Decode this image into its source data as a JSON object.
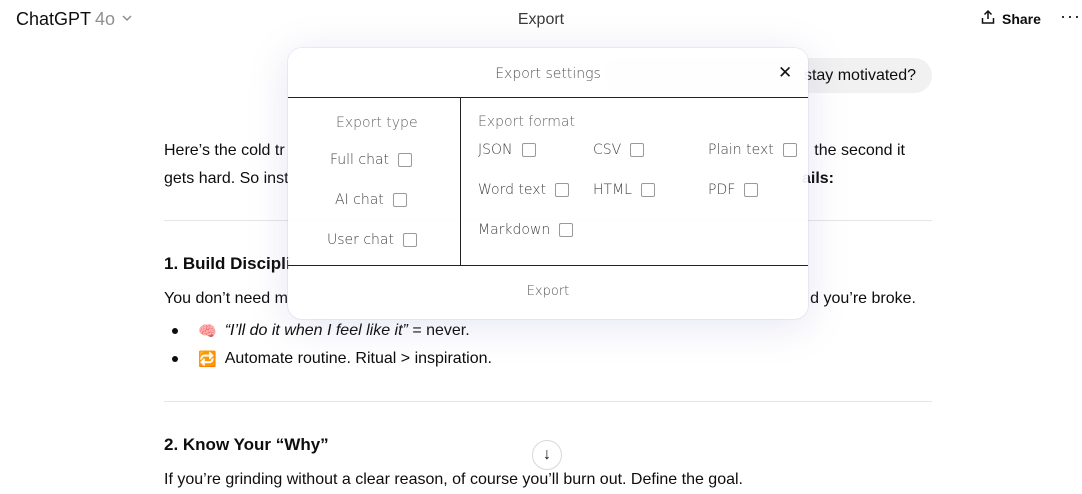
{
  "header": {
    "model_name": "ChatGPT",
    "model_version": "4o",
    "center_title": "Export",
    "share_label": "Share",
    "more_label": "···"
  },
  "conversation": {
    "user_message_visible": "stay motivated?",
    "intro_line1_left": "Here’s the cold tr",
    "intro_line1_right": "the second it",
    "intro_line2_left": "gets hard. So inst",
    "intro_line2_right": "ails:",
    "section1_heading": "1. Build Discipli",
    "section1_text_left": "You don’t need m",
    "section1_text_right": "d you’re broke.",
    "bullets": [
      {
        "emoji": "🧠",
        "text_italic": "“I’ll do it when I feel like it”",
        "text_rest": " = never."
      },
      {
        "emoji": "🔁",
        "text_italic": "",
        "text_rest": "Automate routine. Ritual > inspiration."
      }
    ],
    "section2_heading": "2. Know Your “Why”",
    "section2_text": "If you’re grinding without a clear reason, of course you’ll burn out. Define the goal.",
    "scroll_icon": "↓"
  },
  "modal": {
    "title": "Export settings",
    "close_icon": "✕",
    "export_type_title": "Export type",
    "export_types": [
      "Full chat",
      "AI chat",
      "User chat"
    ],
    "export_format_title": "Export format",
    "export_formats": [
      "JSON",
      "CSV",
      "Plain text",
      "Word text",
      "HTML",
      "PDF",
      "Markdown"
    ],
    "export_button": "Export"
  }
}
